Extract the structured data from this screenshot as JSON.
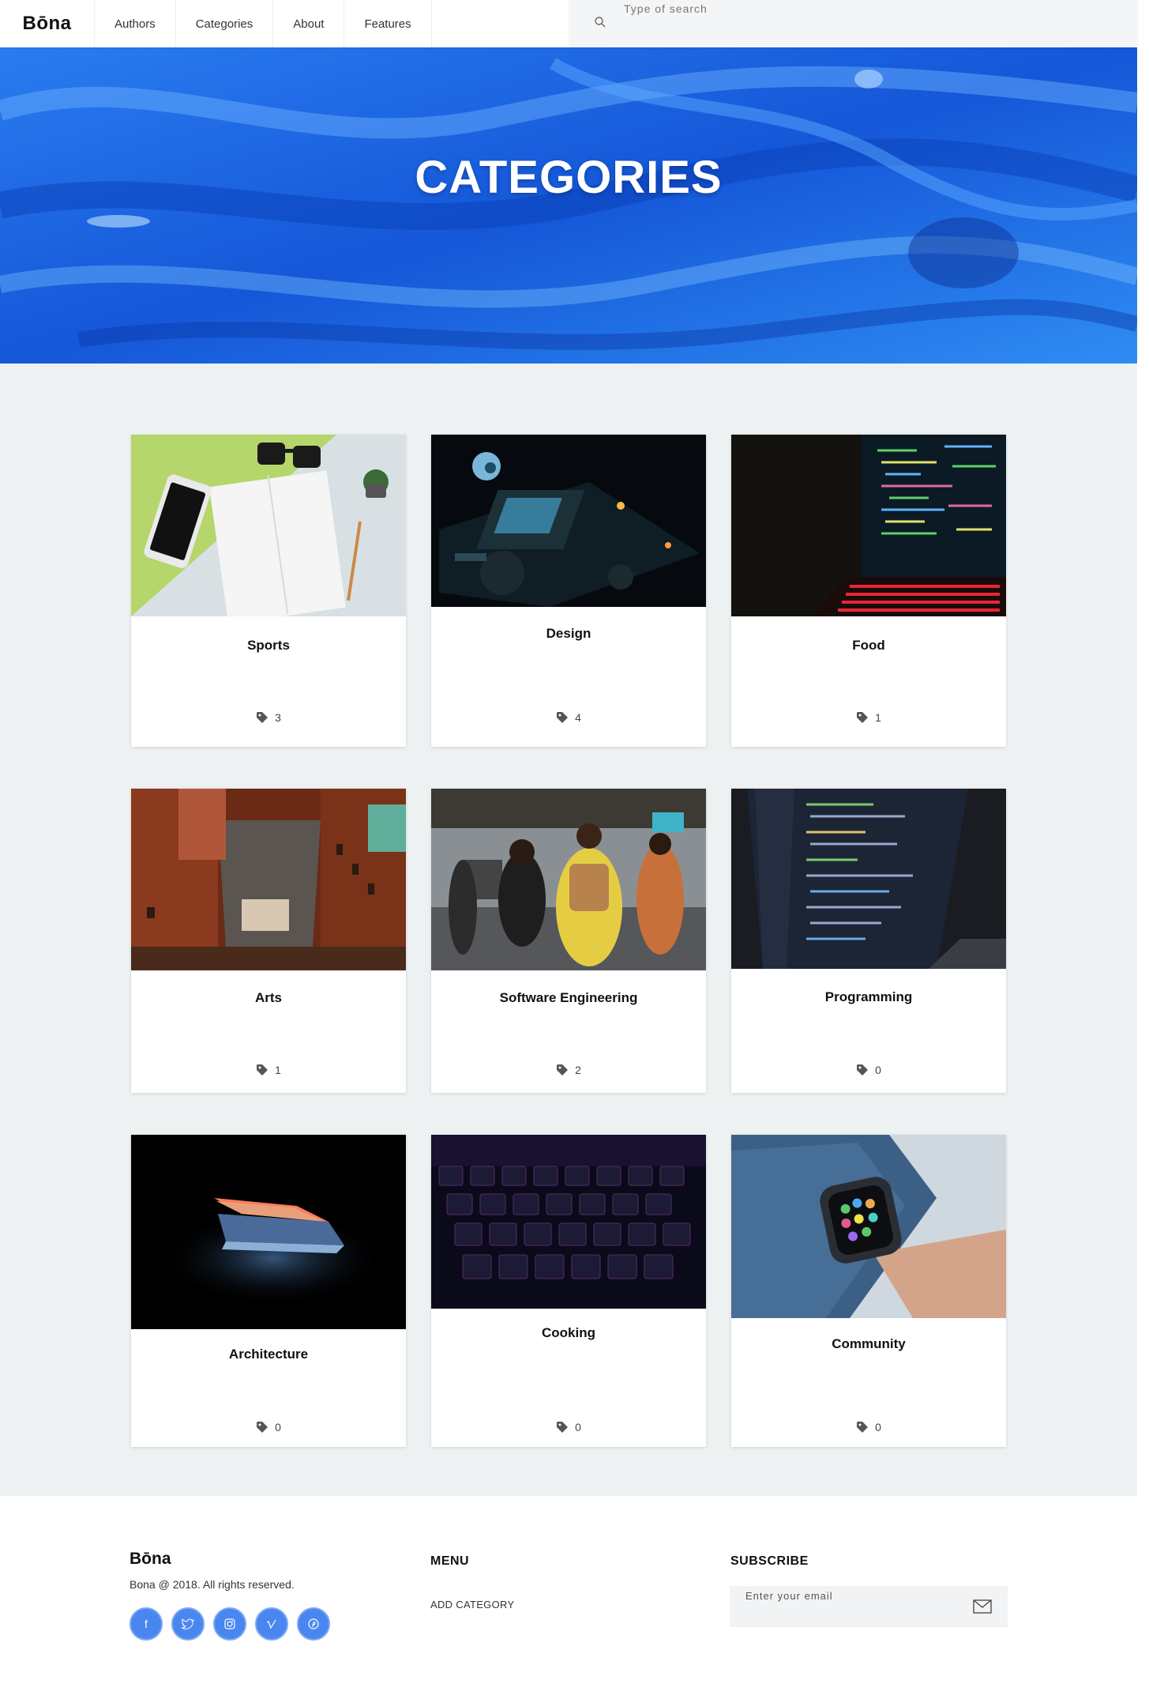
{
  "header": {
    "logo": "Bōna",
    "nav": [
      "Authors",
      "Categories",
      "About",
      "Features"
    ],
    "search_placeholder": "Type of search"
  },
  "hero": {
    "title": "CATEGORIES"
  },
  "categories": [
    {
      "name": "Sports",
      "count": "3"
    },
    {
      "name": "Design",
      "count": "4"
    },
    {
      "name": "Food",
      "count": "1"
    },
    {
      "name": "Arts",
      "count": "1"
    },
    {
      "name": "Software Engineering",
      "count": "2"
    },
    {
      "name": "Programming",
      "count": "0"
    },
    {
      "name": "Architecture",
      "count": "0"
    },
    {
      "name": "Cooking",
      "count": "0"
    },
    {
      "name": "Community",
      "count": "0"
    }
  ],
  "footer": {
    "logo": "Bōna",
    "copyright": "Bona @ 2018. All rights reserved.",
    "menu_heading": "MENU",
    "menu_link": "ADD CATEGORY",
    "subscribe_heading": "SUBSCRIBE",
    "email_placeholder": "Enter your email",
    "socials": [
      "facebook-icon",
      "twitter-icon",
      "instagram-icon",
      "vimeo-icon",
      "pinterest-icon"
    ]
  },
  "colors": {
    "accent": "#4a86f0",
    "hero_blue": "#1a6be0",
    "section_bg": "#edf1f2"
  }
}
